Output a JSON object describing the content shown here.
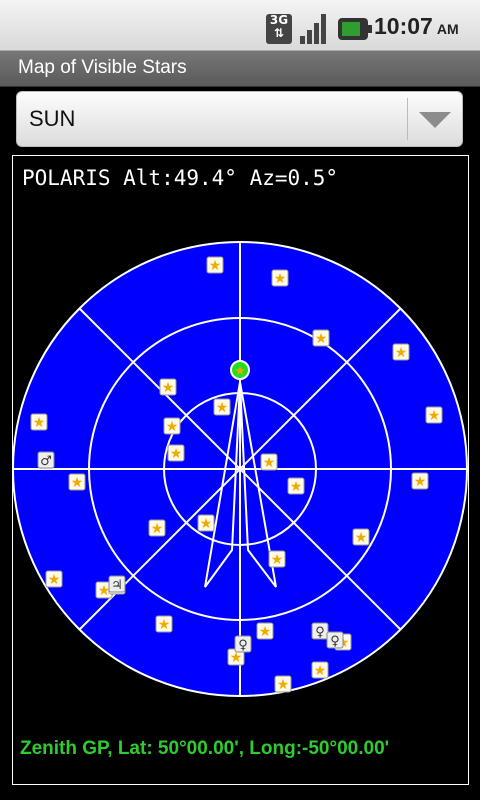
{
  "status_bar": {
    "network": "3G",
    "time": "10:07",
    "ampm": "AM",
    "icons": [
      "network-3g-icon",
      "signal-strength-icon",
      "battery-charging-icon"
    ]
  },
  "app": {
    "title": "Map of Visible Stars"
  },
  "selector": {
    "value": "SUN"
  },
  "readout": "POLARIS Alt:49.4° Az=0.5°",
  "footer": "Zenith GP, Lat: 50°00.00', Long:-50°00.00'",
  "colors": {
    "sky": "#0000ff",
    "grid": "#ffffff",
    "highlight": "#22dd22",
    "star": "#f2a900",
    "footer_text": "#2ecc2e"
  },
  "markers": {
    "stars": 33,
    "planets": 5,
    "highlighted": "POLARIS"
  }
}
